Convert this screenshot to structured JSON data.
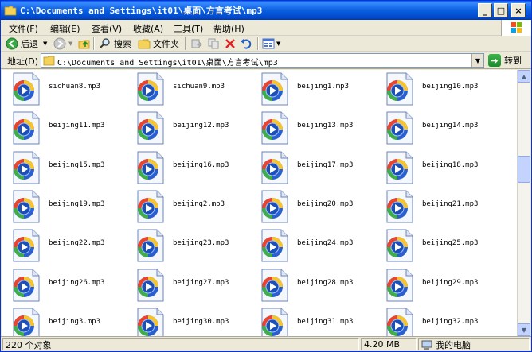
{
  "window": {
    "title": "C:\\Documents and Settings\\it01\\桌面\\方言考试\\mp3",
    "minimize": "_",
    "maximize": "□",
    "close": "×"
  },
  "menu": {
    "items": [
      {
        "label": "文件(F)"
      },
      {
        "label": "编辑(E)"
      },
      {
        "label": "查看(V)"
      },
      {
        "label": "收藏(A)"
      },
      {
        "label": "工具(T)"
      },
      {
        "label": "帮助(H)"
      }
    ]
  },
  "toolbar": {
    "back_label": "后退",
    "search_label": "搜索",
    "folders_label": "文件夹"
  },
  "address": {
    "label": "地址(D)",
    "value": "C:\\Documents and Settings\\it01\\桌面\\方言考试\\mp3",
    "go_label": "转到"
  },
  "files": [
    {
      "name": "sichuan8.mp3"
    },
    {
      "name": "sichuan9.mp3"
    },
    {
      "name": "beijing1.mp3"
    },
    {
      "name": "beijing10.mp3"
    },
    {
      "name": "beijing11.mp3"
    },
    {
      "name": "beijing12.mp3"
    },
    {
      "name": "beijing13.mp3"
    },
    {
      "name": "beijing14.mp3"
    },
    {
      "name": "beijing15.mp3"
    },
    {
      "name": "beijing16.mp3"
    },
    {
      "name": "beijing17.mp3"
    },
    {
      "name": "beijing18.mp3"
    },
    {
      "name": "beijing19.mp3"
    },
    {
      "name": "beijing2.mp3"
    },
    {
      "name": "beijing20.mp3"
    },
    {
      "name": "beijing21.mp3"
    },
    {
      "name": "beijing22.mp3"
    },
    {
      "name": "beijing23.mp3"
    },
    {
      "name": "beijing24.mp3"
    },
    {
      "name": "beijing25.mp3"
    },
    {
      "name": "beijing26.mp3"
    },
    {
      "name": "beijing27.mp3"
    },
    {
      "name": "beijing28.mp3"
    },
    {
      "name": "beijing29.mp3"
    },
    {
      "name": "beijing3.mp3"
    },
    {
      "name": "beijing30.mp3"
    },
    {
      "name": "beijing31.mp3"
    },
    {
      "name": "beijing32.mp3"
    }
  ],
  "status": {
    "count": "220 个对象",
    "size": "4.20 MB",
    "location": "我的电脑"
  },
  "colors": {
    "titlebar": "#0058ee",
    "background": "#ece9d8",
    "content": "#ffffff"
  },
  "icons": {
    "file": "windows-media-audio-icon",
    "title": "folder-icon"
  }
}
